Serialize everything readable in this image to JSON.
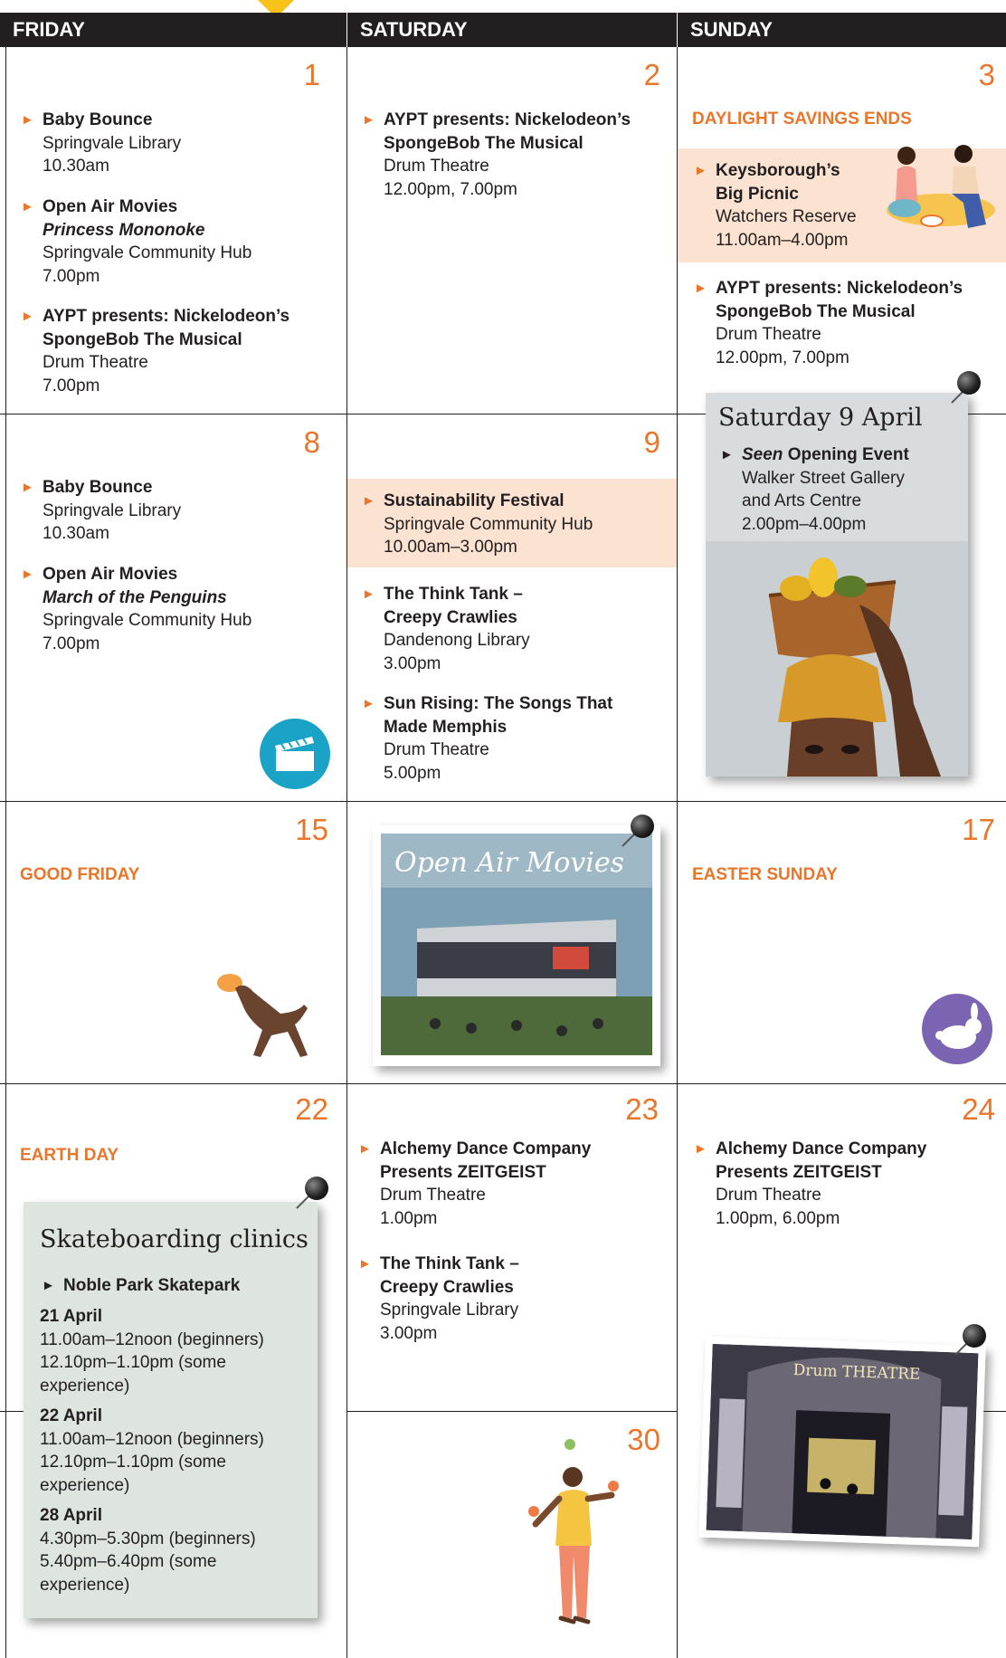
{
  "headers": {
    "friday": "FRIDAY",
    "saturday": "SATURDAY",
    "sunday": "SUNDAY"
  },
  "days": {
    "d1": "1",
    "d2": "2",
    "d3": "3",
    "d8": "8",
    "d9": "9",
    "d15": "15",
    "d17": "17",
    "d22": "22",
    "d23": "23",
    "d24": "24",
    "d30": "30"
  },
  "labels": {
    "daylight": "DAYLIGHT SAVINGS ENDS",
    "good_friday": "GOOD FRIDAY",
    "easter_sunday": "EASTER SUNDAY",
    "earth_day": "EARTH DAY"
  },
  "events": {
    "e1a": {
      "title": "Baby Bounce",
      "lines": [
        "Springvale Library",
        "10.30am"
      ]
    },
    "e1b": {
      "title": "Open Air Movies",
      "subtitle": "Princess Mononoke",
      "lines": [
        "Springvale Community Hub",
        "7.00pm"
      ]
    },
    "e1c": {
      "title1": "AYPT presents: Nickelodeon’s",
      "title2": "SpongeBob The Musical",
      "lines": [
        "Drum Theatre",
        "7.00pm"
      ]
    },
    "e2a": {
      "title1": "AYPT presents: Nickelodeon’s",
      "title2": "SpongeBob The Musical",
      "lines": [
        "Drum Theatre",
        "12.00pm, 7.00pm"
      ]
    },
    "e3a": {
      "title1": "Keysborough’s",
      "title2": "Big Picnic",
      "lines": [
        "Watchers Reserve",
        "11.00am–4.00pm"
      ]
    },
    "e3b": {
      "title1": "AYPT presents: Nickelodeon’s",
      "title2": "SpongeBob The Musical",
      "lines": [
        "Drum Theatre",
        "12.00pm, 7.00pm"
      ]
    },
    "e8a": {
      "title": "Baby Bounce",
      "lines": [
        "Springvale Library",
        "10.30am"
      ]
    },
    "e8b": {
      "title": "Open Air Movies",
      "subtitle": "March of the Penguins",
      "lines": [
        "Springvale Community Hub",
        "7.00pm"
      ]
    },
    "e9a": {
      "title": "Sustainability Festival",
      "lines": [
        "Springvale Community Hub",
        "10.00am–3.00pm"
      ]
    },
    "e9b": {
      "title1": "The Think Tank –",
      "title2": "Creepy Crawlies",
      "lines": [
        "Dandenong Library",
        "3.00pm"
      ]
    },
    "e9c": {
      "title1": "Sun Rising: The Songs That",
      "title2": "Made Memphis",
      "lines": [
        "Drum Theatre",
        "5.00pm"
      ]
    },
    "e23a": {
      "title1": "Alchemy Dance Company",
      "title2": "Presents ZEITGEIST",
      "lines": [
        "Drum Theatre",
        "1.00pm"
      ]
    },
    "e23b": {
      "title1": "The Think Tank –",
      "title2": "Creepy Crawlies",
      "lines": [
        "Springvale Library",
        "3.00pm"
      ]
    },
    "e24a": {
      "title1": "Alchemy Dance Company",
      "title2": "Presents ZEITGEIST",
      "lines": [
        "Drum Theatre",
        "1.00pm, 6.00pm"
      ]
    }
  },
  "seen_card": {
    "title": "Saturday 9 April",
    "event_italic": "Seen",
    "event_rest": " Opening Event",
    "lines": [
      "Walker Street Gallery",
      "and Arts Centre",
      "2.00pm–4.00pm"
    ]
  },
  "movies_card": {
    "overlay": "Open Air Movies"
  },
  "skate_card": {
    "title": "Skateboarding clinics",
    "venue": "Noble Park Skatepark",
    "sessions": [
      {
        "date": "21 April",
        "lines": [
          "11.00am–12noon (beginners)",
          "12.10pm–1.10pm (some",
          "experience)"
        ]
      },
      {
        "date": "22 April",
        "lines": [
          "11.00am–12noon (beginners)",
          "12.10pm–1.10pm (some",
          "experience)"
        ]
      },
      {
        "date": "28 April",
        "lines": [
          "4.30pm–5.30pm (beginners)",
          "5.40pm–6.40pm (some",
          "experience)"
        ]
      }
    ]
  },
  "drum_card": {
    "sign": "Drum THEATRE"
  },
  "colors": {
    "accent": "#e9762b",
    "highlight": "#fbe2d1",
    "header": "#231f20",
    "seen_bg": "#d9dcde",
    "skate_bg": "#dde5de"
  },
  "icons": [
    "clapperboard-icon",
    "dog-icon",
    "rabbit-icon",
    "juggler-illustration",
    "picnic-illustration"
  ]
}
